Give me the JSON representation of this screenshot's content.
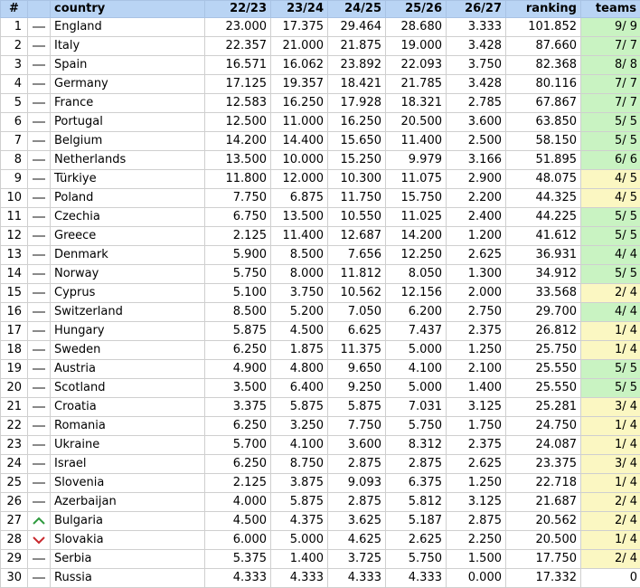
{
  "headers": {
    "idx": "#",
    "trend": "",
    "country": "country",
    "s1": "22/23",
    "s2": "23/24",
    "s3": "24/25",
    "s4": "25/26",
    "s5": "26/27",
    "ranking": "ranking",
    "teams": "teams"
  },
  "colors": {
    "header_bg": "#b9d4f4",
    "teams_full": "#c9f3c2",
    "teams_partial": "#fbf7c2",
    "trend_up": "#2e9a3e",
    "trend_down": "#c8282d",
    "trend_same": "#8a8a8a"
  },
  "rows": [
    {
      "idx": "1",
      "trend": "same",
      "country": "England",
      "s1": "23.000",
      "s2": "17.375",
      "s3": "29.464",
      "s4": "28.680",
      "s5": "3.333",
      "ranking": "101.852",
      "teams": "9/ 9",
      "status": "full"
    },
    {
      "idx": "2",
      "trend": "same",
      "country": "Italy",
      "s1": "22.357",
      "s2": "21.000",
      "s3": "21.875",
      "s4": "19.000",
      "s5": "3.428",
      "ranking": "87.660",
      "teams": "7/ 7",
      "status": "full"
    },
    {
      "idx": "3",
      "trend": "same",
      "country": "Spain",
      "s1": "16.571",
      "s2": "16.062",
      "s3": "23.892",
      "s4": "22.093",
      "s5": "3.750",
      "ranking": "82.368",
      "teams": "8/ 8",
      "status": "full"
    },
    {
      "idx": "4",
      "trend": "same",
      "country": "Germany",
      "s1": "17.125",
      "s2": "19.357",
      "s3": "18.421",
      "s4": "21.785",
      "s5": "3.428",
      "ranking": "80.116",
      "teams": "7/ 7",
      "status": "full"
    },
    {
      "idx": "5",
      "trend": "same",
      "country": "France",
      "s1": "12.583",
      "s2": "16.250",
      "s3": "17.928",
      "s4": "18.321",
      "s5": "2.785",
      "ranking": "67.867",
      "teams": "7/ 7",
      "status": "full"
    },
    {
      "idx": "6",
      "trend": "same",
      "country": "Portugal",
      "s1": "12.500",
      "s2": "11.000",
      "s3": "16.250",
      "s4": "20.500",
      "s5": "3.600",
      "ranking": "63.850",
      "teams": "5/ 5",
      "status": "full"
    },
    {
      "idx": "7",
      "trend": "same",
      "country": "Belgium",
      "s1": "14.200",
      "s2": "14.400",
      "s3": "15.650",
      "s4": "11.400",
      "s5": "2.500",
      "ranking": "58.150",
      "teams": "5/ 5",
      "status": "full"
    },
    {
      "idx": "8",
      "trend": "same",
      "country": "Netherlands",
      "s1": "13.500",
      "s2": "10.000",
      "s3": "15.250",
      "s4": "9.979",
      "s5": "3.166",
      "ranking": "51.895",
      "teams": "6/ 6",
      "status": "full"
    },
    {
      "idx": "9",
      "trend": "same",
      "country": "Türkiye",
      "s1": "11.800",
      "s2": "12.000",
      "s3": "10.300",
      "s4": "11.075",
      "s5": "2.900",
      "ranking": "48.075",
      "teams": "4/ 5",
      "status": "partial"
    },
    {
      "idx": "10",
      "trend": "same",
      "country": "Poland",
      "s1": "7.750",
      "s2": "6.875",
      "s3": "11.750",
      "s4": "15.750",
      "s5": "2.200",
      "ranking": "44.325",
      "teams": "4/ 5",
      "status": "partial"
    },
    {
      "idx": "11",
      "trend": "same",
      "country": "Czechia",
      "s1": "6.750",
      "s2": "13.500",
      "s3": "10.550",
      "s4": "11.025",
      "s5": "2.400",
      "ranking": "44.225",
      "teams": "5/ 5",
      "status": "full"
    },
    {
      "idx": "12",
      "trend": "same",
      "country": "Greece",
      "s1": "2.125",
      "s2": "11.400",
      "s3": "12.687",
      "s4": "14.200",
      "s5": "1.200",
      "ranking": "41.612",
      "teams": "5/ 5",
      "status": "full"
    },
    {
      "idx": "13",
      "trend": "same",
      "country": "Denmark",
      "s1": "5.900",
      "s2": "8.500",
      "s3": "7.656",
      "s4": "12.250",
      "s5": "2.625",
      "ranking": "36.931",
      "teams": "4/ 4",
      "status": "full"
    },
    {
      "idx": "14",
      "trend": "same",
      "country": "Norway",
      "s1": "5.750",
      "s2": "8.000",
      "s3": "11.812",
      "s4": "8.050",
      "s5": "1.300",
      "ranking": "34.912",
      "teams": "5/ 5",
      "status": "full"
    },
    {
      "idx": "15",
      "trend": "same",
      "country": "Cyprus",
      "s1": "5.100",
      "s2": "3.750",
      "s3": "10.562",
      "s4": "12.156",
      "s5": "2.000",
      "ranking": "33.568",
      "teams": "2/ 4",
      "status": "partial"
    },
    {
      "idx": "16",
      "trend": "same",
      "country": "Switzerland",
      "s1": "8.500",
      "s2": "5.200",
      "s3": "7.050",
      "s4": "6.200",
      "s5": "2.750",
      "ranking": "29.700",
      "teams": "4/ 4",
      "status": "full"
    },
    {
      "idx": "17",
      "trend": "same",
      "country": "Hungary",
      "s1": "5.875",
      "s2": "4.500",
      "s3": "6.625",
      "s4": "7.437",
      "s5": "2.375",
      "ranking": "26.812",
      "teams": "1/ 4",
      "status": "partial"
    },
    {
      "idx": "18",
      "trend": "same",
      "country": "Sweden",
      "s1": "6.250",
      "s2": "1.875",
      "s3": "11.375",
      "s4": "5.000",
      "s5": "1.250",
      "ranking": "25.750",
      "teams": "1/ 4",
      "status": "partial"
    },
    {
      "idx": "19",
      "trend": "same",
      "country": "Austria",
      "s1": "4.900",
      "s2": "4.800",
      "s3": "9.650",
      "s4": "4.100",
      "s5": "2.100",
      "ranking": "25.550",
      "teams": "5/ 5",
      "status": "full"
    },
    {
      "idx": "20",
      "trend": "same",
      "country": "Scotland",
      "s1": "3.500",
      "s2": "6.400",
      "s3": "9.250",
      "s4": "5.000",
      "s5": "1.400",
      "ranking": "25.550",
      "teams": "5/ 5",
      "status": "full"
    },
    {
      "idx": "21",
      "trend": "same",
      "country": "Croatia",
      "s1": "3.375",
      "s2": "5.875",
      "s3": "5.875",
      "s4": "7.031",
      "s5": "3.125",
      "ranking": "25.281",
      "teams": "3/ 4",
      "status": "partial"
    },
    {
      "idx": "22",
      "trend": "same",
      "country": "Romania",
      "s1": "6.250",
      "s2": "3.250",
      "s3": "7.750",
      "s4": "5.750",
      "s5": "1.750",
      "ranking": "24.750",
      "teams": "1/ 4",
      "status": "partial"
    },
    {
      "idx": "23",
      "trend": "same",
      "country": "Ukraine",
      "s1": "5.700",
      "s2": "4.100",
      "s3": "3.600",
      "s4": "8.312",
      "s5": "2.375",
      "ranking": "24.087",
      "teams": "1/ 4",
      "status": "partial"
    },
    {
      "idx": "24",
      "trend": "same",
      "country": "Israel",
      "s1": "6.250",
      "s2": "8.750",
      "s3": "2.875",
      "s4": "2.875",
      "s5": "2.625",
      "ranking": "23.375",
      "teams": "3/ 4",
      "status": "partial"
    },
    {
      "idx": "25",
      "trend": "same",
      "country": "Slovenia",
      "s1": "2.125",
      "s2": "3.875",
      "s3": "9.093",
      "s4": "6.375",
      "s5": "1.250",
      "ranking": "22.718",
      "teams": "1/ 4",
      "status": "partial"
    },
    {
      "idx": "26",
      "trend": "same",
      "country": "Azerbaijan",
      "s1": "4.000",
      "s2": "5.875",
      "s3": "2.875",
      "s4": "5.812",
      "s5": "3.125",
      "ranking": "21.687",
      "teams": "2/ 4",
      "status": "partial"
    },
    {
      "idx": "27",
      "trend": "up",
      "country": "Bulgaria",
      "s1": "4.500",
      "s2": "4.375",
      "s3": "3.625",
      "s4": "5.187",
      "s5": "2.875",
      "ranking": "20.562",
      "teams": "2/ 4",
      "status": "partial"
    },
    {
      "idx": "28",
      "trend": "down",
      "country": "Slovakia",
      "s1": "6.000",
      "s2": "5.000",
      "s3": "4.625",
      "s4": "2.625",
      "s5": "2.250",
      "ranking": "20.500",
      "teams": "1/ 4",
      "status": "partial"
    },
    {
      "idx": "29",
      "trend": "same",
      "country": "Serbia",
      "s1": "5.375",
      "s2": "1.400",
      "s3": "3.725",
      "s4": "5.750",
      "s5": "1.500",
      "ranking": "17.750",
      "teams": "2/ 4",
      "status": "partial"
    },
    {
      "idx": "30",
      "trend": "same",
      "country": "Russia",
      "s1": "4.333",
      "s2": "4.333",
      "s3": "4.333",
      "s4": "4.333",
      "s5": "0.000",
      "ranking": "17.332",
      "teams": "0",
      "status": "none"
    }
  ]
}
